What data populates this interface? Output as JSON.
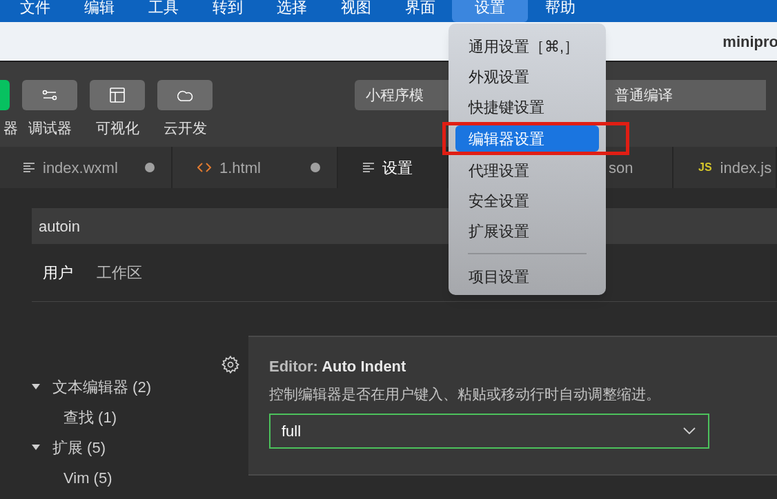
{
  "menubar": [
    {
      "label": "文件",
      "selected": false
    },
    {
      "label": "编辑",
      "selected": false
    },
    {
      "label": "工具",
      "selected": false
    },
    {
      "label": "转到",
      "selected": false
    },
    {
      "label": "选择",
      "selected": false
    },
    {
      "label": "视图",
      "selected": false
    },
    {
      "label": "界面",
      "selected": false
    },
    {
      "label": "设置",
      "selected": true
    },
    {
      "label": "帮助",
      "selected": false
    }
  ],
  "title_bar": {
    "title": "minipro"
  },
  "toolbar": {
    "buttons": [
      {
        "kind": "simulator",
        "label": "器"
      },
      {
        "kind": "debugger",
        "label": "调试器"
      },
      {
        "kind": "visual",
        "label": "可视化"
      },
      {
        "kind": "cloud",
        "label": "云开发"
      }
    ],
    "mode_select": "小程序模",
    "compile_select": "普通编译"
  },
  "editor_tabs": [
    {
      "kind": "lines",
      "label": "index.wxml",
      "modified": true,
      "selected": false
    },
    {
      "kind": "code",
      "label": "1.html",
      "modified": true,
      "selected": false
    },
    {
      "kind": "lines",
      "label": "设置",
      "modified": false,
      "selected": true
    },
    {
      "kind": "plain",
      "label": "son",
      "modified": false,
      "selected": false
    },
    {
      "kind": "badge",
      "badge": "JS",
      "label": "index.js",
      "modified": false,
      "selected": false
    }
  ],
  "settings": {
    "search": {
      "value": "autoin"
    },
    "scope_tabs": [
      {
        "label": "用户",
        "selected": true
      },
      {
        "label": "工作区",
        "selected": false
      }
    ],
    "toc": [
      {
        "label": "文本编辑器 (2)",
        "expanded": true,
        "children": [
          {
            "label": "查找 (1)"
          }
        ]
      },
      {
        "label": "扩展 (5)",
        "expanded": true,
        "children": [
          {
            "label": "Vim (5)"
          }
        ]
      }
    ],
    "setting": {
      "category": "Editor: ",
      "name": "Auto Indent",
      "description": "控制编辑器是否在用户键入、粘贴或移动行时自动调整缩进。",
      "value": "full"
    }
  },
  "dropdown_menu": {
    "items": [
      {
        "kind": "item",
        "label": "通用设置［⌘,］",
        "selected": false
      },
      {
        "kind": "item",
        "label": "外观设置",
        "selected": false
      },
      {
        "kind": "item",
        "label": "快捷键设置",
        "selected": false
      },
      {
        "kind": "item",
        "label": "编辑器设置",
        "selected": true
      },
      {
        "kind": "item",
        "label": "代理设置",
        "selected": false
      },
      {
        "kind": "item",
        "label": "安全设置",
        "selected": false
      },
      {
        "kind": "item",
        "label": "扩展设置",
        "selected": false
      },
      {
        "kind": "separator"
      },
      {
        "kind": "item",
        "label": "项目设置",
        "selected": false
      }
    ]
  }
}
